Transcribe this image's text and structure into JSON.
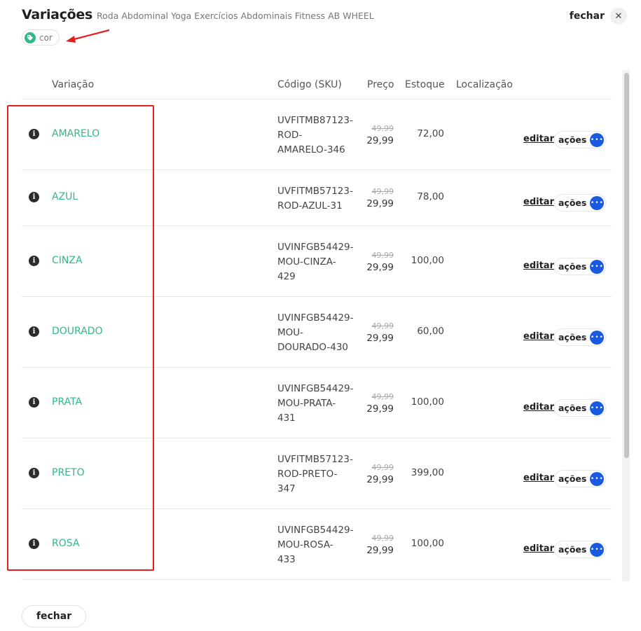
{
  "header": {
    "title": "Variações",
    "subtitle": "Roda Abdominal Yoga Exercícios Abdominais Fitness AB WHEEL",
    "close_label": "fechar",
    "close_icon": "✕"
  },
  "tag": {
    "label": "cor",
    "icon": "tag-icon",
    "icon_color": "#2fb889"
  },
  "table": {
    "columns": [
      "Variação",
      "Código (SKU)",
      "Preço",
      "Estoque",
      "Localização"
    ],
    "rows": [
      {
        "variation": "AMARELO",
        "sku_lines": [
          "UVFITMB87123-",
          "ROD-",
          "AMARELO-346"
        ],
        "old_price": "49,99",
        "price": "29,99",
        "stock": "72,00",
        "edit": "editar",
        "actions": "ações"
      },
      {
        "variation": "AZUL",
        "sku_lines": [
          "UVFITMB57123-",
          "ROD-AZUL-31"
        ],
        "old_price": "49,99",
        "price": "29,99",
        "stock": "78,00",
        "edit": "editar",
        "actions": "ações"
      },
      {
        "variation": "CINZA",
        "sku_lines": [
          "UVINFGB54429-",
          "MOU-CINZA-",
          "429"
        ],
        "old_price": "49,99",
        "price": "29,99",
        "stock": "100,00",
        "edit": "editar",
        "actions": "ações"
      },
      {
        "variation": "DOURADO",
        "sku_lines": [
          "UVINFGB54429-",
          "MOU-",
          "DOURADO-430"
        ],
        "old_price": "49,99",
        "price": "29,99",
        "stock": "60,00",
        "edit": "editar",
        "actions": "ações"
      },
      {
        "variation": "PRATA",
        "sku_lines": [
          "UVINFGB54429-",
          "MOU-PRATA-",
          "431"
        ],
        "old_price": "49,99",
        "price": "29,99",
        "stock": "100,00",
        "edit": "editar",
        "actions": "ações"
      },
      {
        "variation": "PRETO",
        "sku_lines": [
          "UVFITMB57123-",
          "ROD-PRETO-",
          "347"
        ],
        "old_price": "49,99",
        "price": "29,99",
        "stock": "399,00",
        "edit": "editar",
        "actions": "ações"
      },
      {
        "variation": "ROSA",
        "sku_lines": [
          "UVINFGB54429-",
          "MOU-ROSA-",
          "433"
        ],
        "old_price": "49,99",
        "price": "29,99",
        "stock": "100,00",
        "edit": "editar",
        "actions": "ações"
      }
    ]
  },
  "footer": {
    "close_label": "fechar"
  },
  "colors": {
    "accent": "#2fb889",
    "action_blue": "#1a5ae0",
    "highlight_red": "#e41e1e"
  }
}
